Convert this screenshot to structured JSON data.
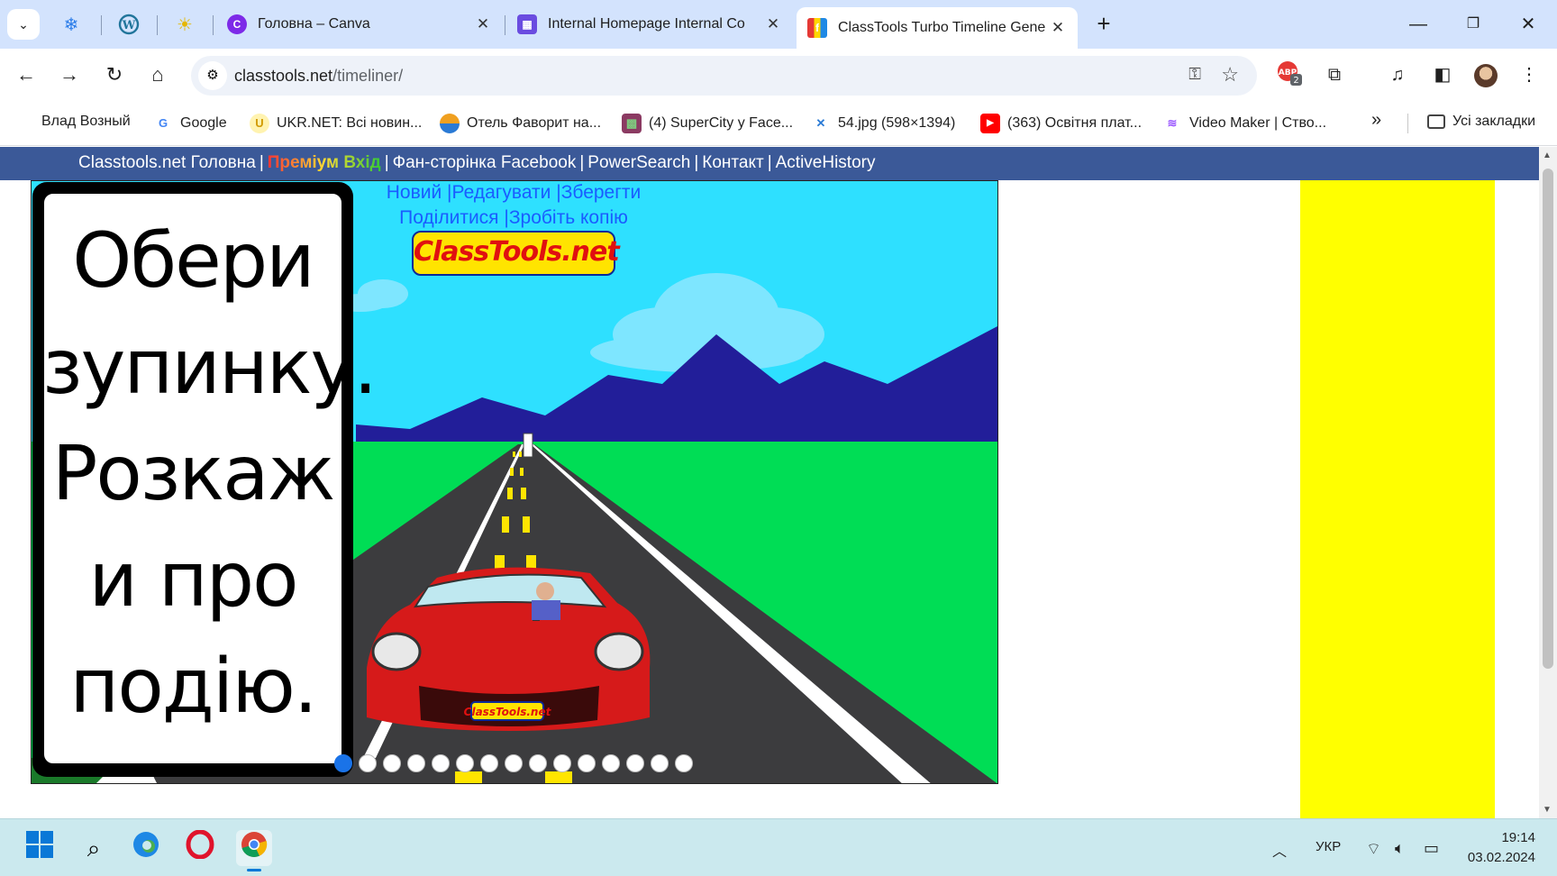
{
  "browser": {
    "tabs": [
      {
        "title": "Головна – Canva",
        "icon": "canva-icon",
        "color": "#7d2ae8",
        "glyph": "C"
      },
      {
        "title": "Internal Homepage Internal Co",
        "icon": "calendar-icon",
        "color": "#6a4ce0",
        "glyph": "▦"
      },
      {
        "title": "ClassTools Turbo Timeline Gene",
        "icon": "classtools-icon",
        "color": "#e53935",
        "glyph": "f"
      }
    ],
    "active_tab_index": 2,
    "new_tab_label": "+",
    "url": {
      "host": "classtools.net",
      "path": "/timeliner/"
    },
    "extension_badge": "2",
    "bookmarks": [
      {
        "label": "Влад Возный",
        "icon": "",
        "color": ""
      },
      {
        "label": "Google",
        "icon": "google-icon",
        "color": "#4285f4",
        "glyph": "G"
      },
      {
        "label": "UKR.NET: Всі новин...",
        "icon": "ukrnet-icon",
        "color": "#f5c518",
        "glyph": "U"
      },
      {
        "label": "Отель Фаворит на...",
        "icon": "hotel-icon",
        "color": "#f0a020",
        "glyph": "◐"
      },
      {
        "label": "(4) SuperCity у Face...",
        "icon": "supercity-icon",
        "color": "#8b3a62",
        "glyph": "▩"
      },
      {
        "label": "54.jpg (598×1394)",
        "icon": "tools-icon",
        "color": "#2a7ad5",
        "glyph": "✕"
      },
      {
        "label": "(363) Освітня плат...",
        "icon": "youtube-icon",
        "color": "#ff0000",
        "glyph": "▶"
      },
      {
        "label": "Video Maker | Ство...",
        "icon": "videomaker-icon",
        "color": "#9b59ff",
        "glyph": "≋"
      }
    ],
    "bookmarks_overflow": "»",
    "all_bookmarks": "Усі закладки"
  },
  "site_nav": {
    "home": "Classtools.net Головна",
    "premium": "Преміум Вхід",
    "facebook": "Фан-сторінка Facebook",
    "powersearch": "PowerSearch",
    "contact": "Контакт",
    "activehistory": "ActiveHistory",
    "separator": "|"
  },
  "timeline": {
    "actions": {
      "new": "Новий",
      "edit": "Редагувати",
      "save": "Зберегти",
      "share": "Поділитися",
      "copy": "Зробіть копію"
    },
    "logo_text": "ClassTools.net",
    "card_text": "Обери зупинку. Розкаж и про подію.",
    "card_lines": [
      "Обери",
      "зупинку.",
      "Розкаж",
      "и про",
      "подію."
    ],
    "total_stops": 15,
    "active_stop": 0,
    "colors": {
      "sky": "#2ee0ff",
      "grass": "#00dd55",
      "mountains": "#221e99",
      "road": "#3c3c3e",
      "car": "#d61a1a"
    }
  },
  "taskbar": {
    "lang": "УКР",
    "time": "19:14",
    "date": "03.02.2024"
  }
}
